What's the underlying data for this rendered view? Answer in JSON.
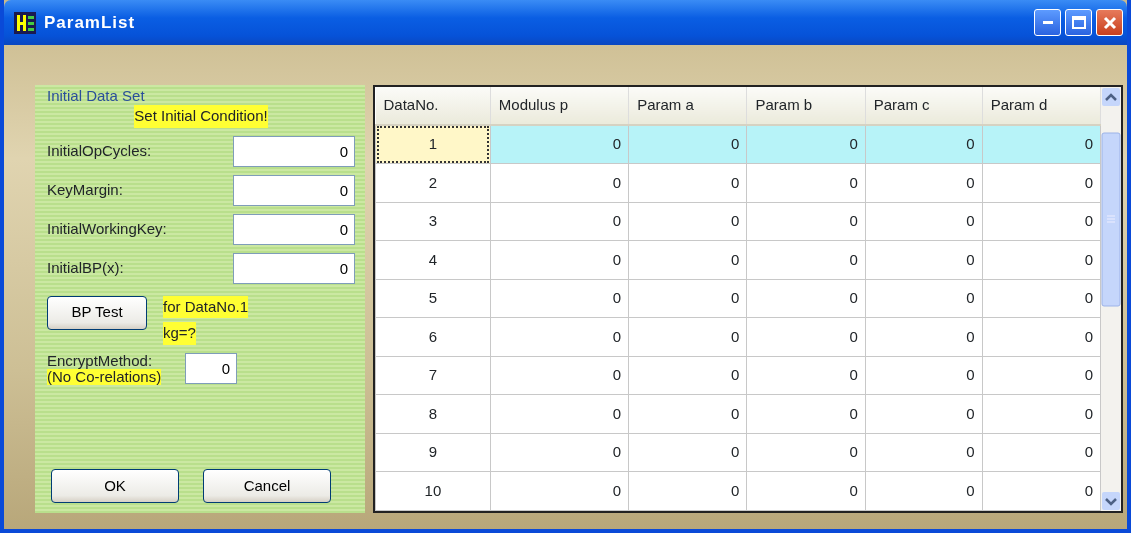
{
  "window": {
    "title": "ParamList"
  },
  "left_panel": {
    "group_title": "Initial Data Set",
    "notice": "Set Initial Condition!",
    "fields": [
      {
        "label": "InitialOpCycles:",
        "value": "0"
      },
      {
        "label": "KeyMargin:",
        "value": "0"
      },
      {
        "label": "InitialWorkingKey:",
        "value": "0"
      },
      {
        "label": "InitialBP(x):",
        "value": "0"
      }
    ],
    "test_button": "BP Test",
    "test_note_1": "for DataNo.1",
    "test_note_2": "kg=?",
    "encrypt": {
      "label": "EncryptMethod:",
      "note": "(No Co-relations)",
      "value": "0"
    },
    "buttons": [
      "OK",
      "Cancel"
    ]
  },
  "table": {
    "columns": [
      "DataNo.",
      "Modulus p",
      "Param a",
      "Param b",
      "Param c",
      "Param d"
    ],
    "rows": [
      {
        "cells": [
          "1",
          "0",
          "0",
          "0",
          "0",
          "0"
        ],
        "selected": true
      },
      {
        "cells": [
          "2",
          "0",
          "0",
          "0",
          "0",
          "0"
        ],
        "selected": false
      },
      {
        "cells": [
          "3",
          "0",
          "0",
          "0",
          "0",
          "0"
        ],
        "selected": false
      },
      {
        "cells": [
          "4",
          "0",
          "0",
          "0",
          "0",
          "0"
        ],
        "selected": false
      },
      {
        "cells": [
          "5",
          "0",
          "0",
          "0",
          "0",
          "0"
        ],
        "selected": false
      },
      {
        "cells": [
          "6",
          "0",
          "0",
          "0",
          "0",
          "0"
        ],
        "selected": false
      },
      {
        "cells": [
          "7",
          "0",
          "0",
          "0",
          "0",
          "0"
        ],
        "selected": false
      },
      {
        "cells": [
          "8",
          "0",
          "0",
          "0",
          "0",
          "0"
        ],
        "selected": false
      },
      {
        "cells": [
          "9",
          "0",
          "0",
          "0",
          "0",
          "0"
        ],
        "selected": false
      },
      {
        "cells": [
          "10",
          "0",
          "0",
          "0",
          "0",
          "0"
        ],
        "selected": false
      }
    ]
  }
}
